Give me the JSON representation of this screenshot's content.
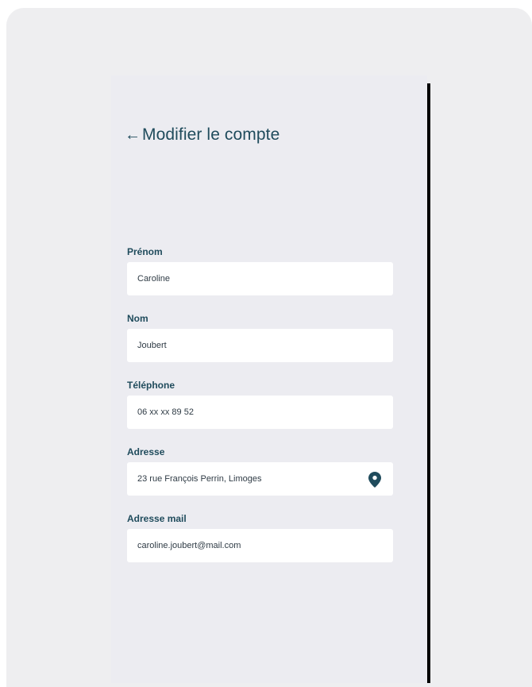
{
  "header": {
    "back_icon": "←",
    "title": "Modifier le compte"
  },
  "form": {
    "fields": [
      {
        "label": "Prénom",
        "value": "Caroline"
      },
      {
        "label": "Nom",
        "value": "Joubert"
      },
      {
        "label": "Téléphone",
        "value": "06 xx xx 89 52"
      },
      {
        "label": "Adresse",
        "value": "23 rue François Perrin, Limoges",
        "icon": "location-pin-icon"
      },
      {
        "label": "Adresse mail",
        "value": "caroline.joubert@mail.com"
      }
    ]
  },
  "colors": {
    "accent": "#1f4b5c",
    "background": "#ececf1",
    "field_background": "#ffffff"
  }
}
